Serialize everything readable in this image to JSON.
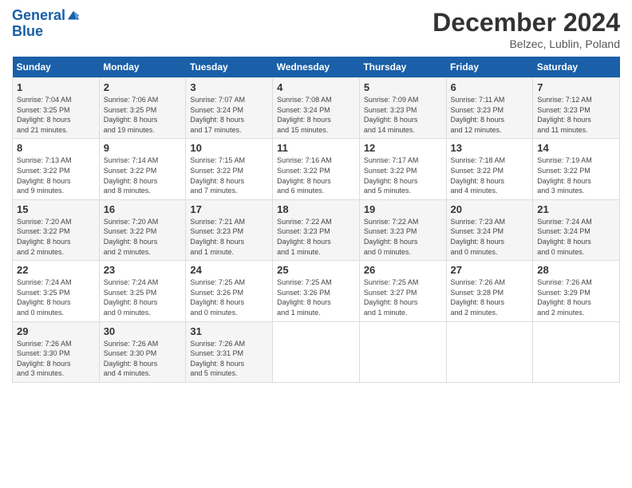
{
  "header": {
    "logo_line1": "General",
    "logo_line2": "Blue",
    "month": "December 2024",
    "location": "Belzec, Lublin, Poland"
  },
  "days_of_week": [
    "Sunday",
    "Monday",
    "Tuesday",
    "Wednesday",
    "Thursday",
    "Friday",
    "Saturday"
  ],
  "weeks": [
    [
      {
        "day": "1",
        "info": "Sunrise: 7:04 AM\nSunset: 3:25 PM\nDaylight: 8 hours\nand 21 minutes."
      },
      {
        "day": "2",
        "info": "Sunrise: 7:06 AM\nSunset: 3:25 PM\nDaylight: 8 hours\nand 19 minutes."
      },
      {
        "day": "3",
        "info": "Sunrise: 7:07 AM\nSunset: 3:24 PM\nDaylight: 8 hours\nand 17 minutes."
      },
      {
        "day": "4",
        "info": "Sunrise: 7:08 AM\nSunset: 3:24 PM\nDaylight: 8 hours\nand 15 minutes."
      },
      {
        "day": "5",
        "info": "Sunrise: 7:09 AM\nSunset: 3:23 PM\nDaylight: 8 hours\nand 14 minutes."
      },
      {
        "day": "6",
        "info": "Sunrise: 7:11 AM\nSunset: 3:23 PM\nDaylight: 8 hours\nand 12 minutes."
      },
      {
        "day": "7",
        "info": "Sunrise: 7:12 AM\nSunset: 3:23 PM\nDaylight: 8 hours\nand 11 minutes."
      }
    ],
    [
      {
        "day": "8",
        "info": "Sunrise: 7:13 AM\nSunset: 3:22 PM\nDaylight: 8 hours\nand 9 minutes."
      },
      {
        "day": "9",
        "info": "Sunrise: 7:14 AM\nSunset: 3:22 PM\nDaylight: 8 hours\nand 8 minutes."
      },
      {
        "day": "10",
        "info": "Sunrise: 7:15 AM\nSunset: 3:22 PM\nDaylight: 8 hours\nand 7 minutes."
      },
      {
        "day": "11",
        "info": "Sunrise: 7:16 AM\nSunset: 3:22 PM\nDaylight: 8 hours\nand 6 minutes."
      },
      {
        "day": "12",
        "info": "Sunrise: 7:17 AM\nSunset: 3:22 PM\nDaylight: 8 hours\nand 5 minutes."
      },
      {
        "day": "13",
        "info": "Sunrise: 7:18 AM\nSunset: 3:22 PM\nDaylight: 8 hours\nand 4 minutes."
      },
      {
        "day": "14",
        "info": "Sunrise: 7:19 AM\nSunset: 3:22 PM\nDaylight: 8 hours\nand 3 minutes."
      }
    ],
    [
      {
        "day": "15",
        "info": "Sunrise: 7:20 AM\nSunset: 3:22 PM\nDaylight: 8 hours\nand 2 minutes."
      },
      {
        "day": "16",
        "info": "Sunrise: 7:20 AM\nSunset: 3:22 PM\nDaylight: 8 hours\nand 2 minutes."
      },
      {
        "day": "17",
        "info": "Sunrise: 7:21 AM\nSunset: 3:23 PM\nDaylight: 8 hours\nand 1 minute."
      },
      {
        "day": "18",
        "info": "Sunrise: 7:22 AM\nSunset: 3:23 PM\nDaylight: 8 hours\nand 1 minute."
      },
      {
        "day": "19",
        "info": "Sunrise: 7:22 AM\nSunset: 3:23 PM\nDaylight: 8 hours\nand 0 minutes."
      },
      {
        "day": "20",
        "info": "Sunrise: 7:23 AM\nSunset: 3:24 PM\nDaylight: 8 hours\nand 0 minutes."
      },
      {
        "day": "21",
        "info": "Sunrise: 7:24 AM\nSunset: 3:24 PM\nDaylight: 8 hours\nand 0 minutes."
      }
    ],
    [
      {
        "day": "22",
        "info": "Sunrise: 7:24 AM\nSunset: 3:25 PM\nDaylight: 8 hours\nand 0 minutes."
      },
      {
        "day": "23",
        "info": "Sunrise: 7:24 AM\nSunset: 3:25 PM\nDaylight: 8 hours\nand 0 minutes."
      },
      {
        "day": "24",
        "info": "Sunrise: 7:25 AM\nSunset: 3:26 PM\nDaylight: 8 hours\nand 0 minutes."
      },
      {
        "day": "25",
        "info": "Sunrise: 7:25 AM\nSunset: 3:26 PM\nDaylight: 8 hours\nand 1 minute."
      },
      {
        "day": "26",
        "info": "Sunrise: 7:25 AM\nSunset: 3:27 PM\nDaylight: 8 hours\nand 1 minute."
      },
      {
        "day": "27",
        "info": "Sunrise: 7:26 AM\nSunset: 3:28 PM\nDaylight: 8 hours\nand 2 minutes."
      },
      {
        "day": "28",
        "info": "Sunrise: 7:26 AM\nSunset: 3:29 PM\nDaylight: 8 hours\nand 2 minutes."
      }
    ],
    [
      {
        "day": "29",
        "info": "Sunrise: 7:26 AM\nSunset: 3:30 PM\nDaylight: 8 hours\nand 3 minutes."
      },
      {
        "day": "30",
        "info": "Sunrise: 7:26 AM\nSunset: 3:30 PM\nDaylight: 8 hours\nand 4 minutes."
      },
      {
        "day": "31",
        "info": "Sunrise: 7:26 AM\nSunset: 3:31 PM\nDaylight: 8 hours\nand 5 minutes."
      },
      {
        "day": "",
        "info": ""
      },
      {
        "day": "",
        "info": ""
      },
      {
        "day": "",
        "info": ""
      },
      {
        "day": "",
        "info": ""
      }
    ]
  ]
}
